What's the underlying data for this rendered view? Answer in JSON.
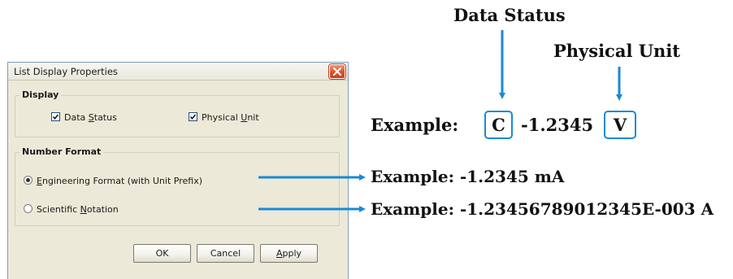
{
  "dialog": {
    "title": "List Display Properties",
    "close_icon": "close-icon",
    "display_group": {
      "legend": "Display",
      "data_status": {
        "pre": "Data ",
        "accel": "S",
        "post": "tatus",
        "checked": true
      },
      "physical_unit": {
        "pre": "Physical ",
        "accel": "U",
        "post": "nit",
        "checked": true
      }
    },
    "number_format_group": {
      "legend": "Number Format",
      "engineering": {
        "pre": "",
        "accel": "E",
        "post": "ngineering Format (with Unit Prefix)",
        "selected": true
      },
      "scientific": {
        "pre": "Scientific ",
        "accel": "N",
        "post": "otation",
        "selected": false
      }
    },
    "buttons": {
      "ok": "OK",
      "cancel": "Cancel",
      "apply_accel": "A",
      "apply_post": "pply"
    }
  },
  "annotations": {
    "data_status_label": "Data Status",
    "physical_unit_label": "Physical Unit",
    "example_label": "Example:",
    "status_letter": "C",
    "value": "-1.2345",
    "unit_letter": "V",
    "engineering_example": "Example: -1.2345 mA",
    "scientific_example": "Example: -1.23456789012345E-003 A"
  },
  "colors": {
    "accent_arrow": "#1a8ad4",
    "dialog_face": "#ece9d8",
    "close_button": "#d9542c"
  }
}
